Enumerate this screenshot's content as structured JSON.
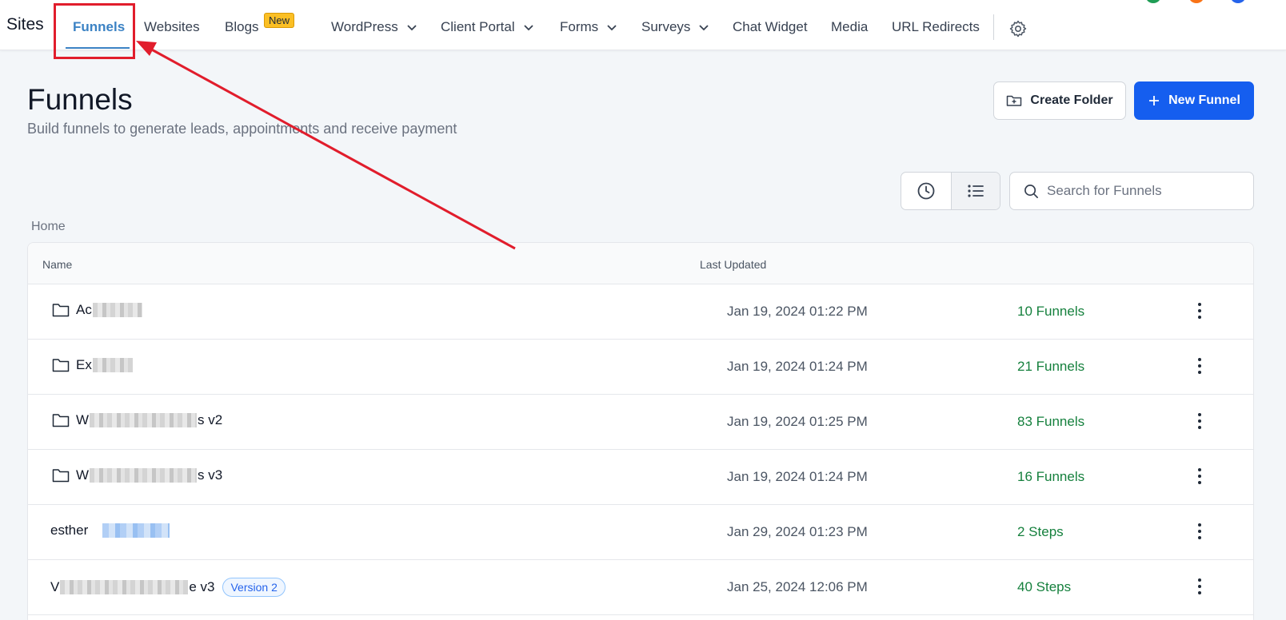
{
  "nav": {
    "brand": "Sites",
    "items": [
      {
        "label": "Funnels",
        "active": true
      },
      {
        "label": "Websites"
      },
      {
        "label": "Blogs",
        "badge": "New"
      },
      {
        "label": "WordPress",
        "dropdown": true
      },
      {
        "label": "Client Portal",
        "dropdown": true
      },
      {
        "label": "Forms",
        "dropdown": true
      },
      {
        "label": "Surveys",
        "dropdown": true
      },
      {
        "label": "Chat Widget"
      },
      {
        "label": "Media"
      },
      {
        "label": "URL Redirects"
      }
    ],
    "settings_icon": "gear-icon"
  },
  "header": {
    "title": "Funnels",
    "subtitle": "Build funnels to generate leads, appointments and receive payment",
    "create_folder_label": "Create Folder",
    "new_funnel_label": "New Funnel"
  },
  "search": {
    "placeholder": "Search for Funnels"
  },
  "breadcrumb": "Home",
  "table": {
    "columns": [
      "Name",
      "Last Updated"
    ],
    "rows": [
      {
        "type": "folder",
        "name_prefix": "Ac",
        "name_suffix": "",
        "updated": "Jan 19, 2024 01:22 PM",
        "count": "10 Funnels"
      },
      {
        "type": "folder",
        "name_prefix": "Ex",
        "name_suffix": "",
        "updated": "Jan 19, 2024 01:24 PM",
        "count": "21 Funnels"
      },
      {
        "type": "folder",
        "name_prefix": "W",
        "name_suffix": "s v2",
        "updated": "Jan 19, 2024 01:25 PM",
        "count": "83 Funnels"
      },
      {
        "type": "folder",
        "name_prefix": "W",
        "name_suffix": "s v3",
        "updated": "Jan 19, 2024 01:24 PM",
        "count": "16 Funnels"
      },
      {
        "type": "funnel",
        "name_prefix": "esther",
        "name_suffix": "",
        "updated": "Jan 29, 2024 01:23 PM",
        "count": "2 Steps"
      },
      {
        "type": "funnel",
        "name_prefix": "V",
        "name_suffix": "e v3",
        "badge": "Version 2",
        "updated": "Jan 25, 2024 12:06 PM",
        "count": "40 Steps"
      }
    ]
  },
  "colors": {
    "accent": "#3b82c4",
    "primary_button": "#155eef",
    "count_green": "#15803d",
    "annotation_red": "#e11d2c",
    "badge_new": "#fbbf24"
  }
}
